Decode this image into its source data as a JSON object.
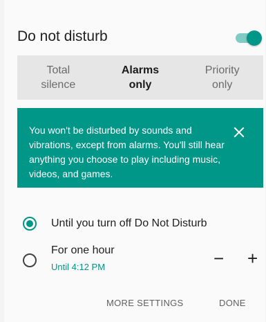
{
  "header": {
    "title": "Do not disturb",
    "toggle_on": true
  },
  "modes": [
    {
      "line1": "Total",
      "line2": "silence",
      "selected": false
    },
    {
      "line1": "Alarms",
      "line2": "only",
      "selected": true
    },
    {
      "line1": "Priority",
      "line2": "only",
      "selected": false
    }
  ],
  "info": {
    "text": "You won't be disturbed by sounds and vibrations, except from alarms. You'll still hear anything you choose to play including music, videos, and games.",
    "close_icon": "close-icon"
  },
  "options": {
    "until_off": {
      "label": "Until you turn off Do Not Disturb",
      "selected": true
    },
    "one_hour": {
      "label": "For one hour",
      "sub": "Until 4:12 PM",
      "selected": false,
      "decrease": "−",
      "increase": "+"
    }
  },
  "actions": {
    "more_settings": "MORE SETTINGS",
    "done": "DONE"
  },
  "colors": {
    "accent": "#009688",
    "accent_light": "#80cbc4",
    "segment_bg": "#e6e6e6"
  }
}
